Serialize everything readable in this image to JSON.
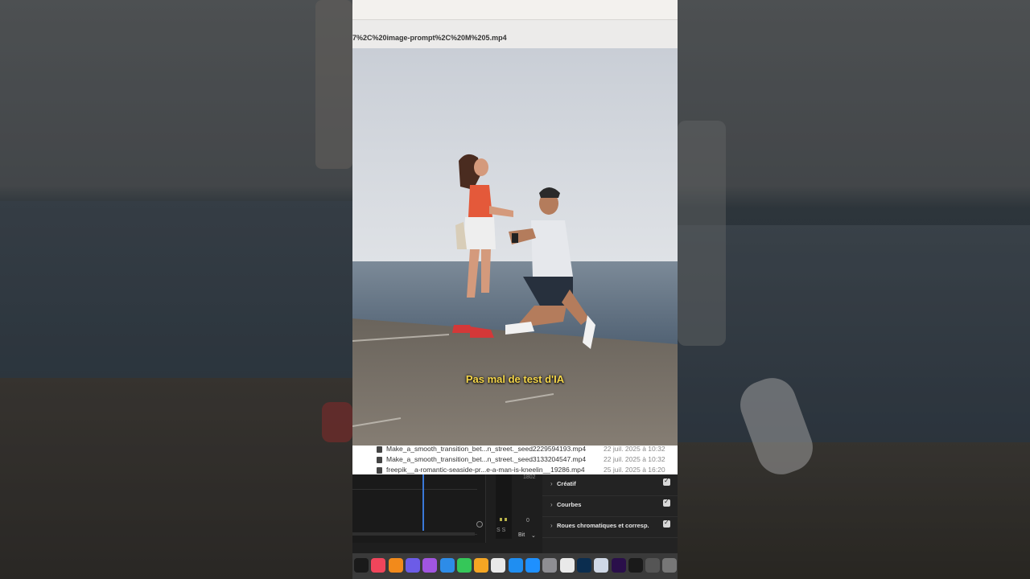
{
  "window": {
    "title": "7%2C%20image-prompt%2C%20M%205.mp4"
  },
  "video": {
    "subtitle": "Pas mal de test d'IA"
  },
  "files": [
    {
      "name": "Make_a_smooth_transition_bet...n_street._seed2229594193.mp4",
      "date": "22 juil. 2025 à 10:32"
    },
    {
      "name": "Make_a_smooth_transition_bet...n_street._seed3133204547.mp4",
      "date": "22 juil. 2025 à 10:32"
    },
    {
      "name": "freepik__a-romantic-seaside-pr...e-a-man-is-kneelin__19286.mp4",
      "date": "25 juil. 2025 à 16:20"
    }
  ],
  "meter": {
    "scale_top": "1802",
    "zero": "0",
    "left_label": "S S",
    "bit_label": "Bit"
  },
  "panels": [
    {
      "label": "Créatif",
      "checked": true
    },
    {
      "label": "Courbes",
      "checked": true
    },
    {
      "label": "Roues chromatiques et corresp.",
      "checked": true
    }
  ],
  "dock": {
    "apps": [
      {
        "icon": "apple-tv-icon",
        "color": "#1a1a1a"
      },
      {
        "icon": "music-icon",
        "color": "#f0455b"
      },
      {
        "icon": "vlc-icon",
        "color": "#f28a1b"
      },
      {
        "icon": "star-icon",
        "color": "#6c5ce7"
      },
      {
        "icon": "podcasts-icon",
        "color": "#a155e0"
      },
      {
        "icon": "keynote-icon",
        "color": "#2d8ce8"
      },
      {
        "icon": "numbers-icon",
        "color": "#35c759"
      },
      {
        "icon": "pages-icon",
        "color": "#f5a623"
      },
      {
        "icon": "chrome-icon",
        "color": "#e9e9e9"
      },
      {
        "icon": "app-store-icon",
        "color": "#1f8ef1"
      },
      {
        "icon": "safari-icon",
        "color": "#1e90ff"
      },
      {
        "icon": "system-settings-icon",
        "color": "#8e8e93"
      },
      {
        "icon": "chrome-alt-icon",
        "color": "#e9e9e9"
      },
      {
        "icon": "photoshop-icon",
        "color": "#0b2d4f"
      },
      {
        "icon": "preview-icon",
        "color": "#cfd8e6"
      },
      {
        "icon": "premiere-icon",
        "color": "#2a0f4a"
      },
      {
        "icon": "folder-icon",
        "color": "#1a1a1a"
      },
      {
        "icon": "tool-icon",
        "color": "#555"
      },
      {
        "icon": "trash-icon",
        "color": "#777"
      }
    ]
  }
}
